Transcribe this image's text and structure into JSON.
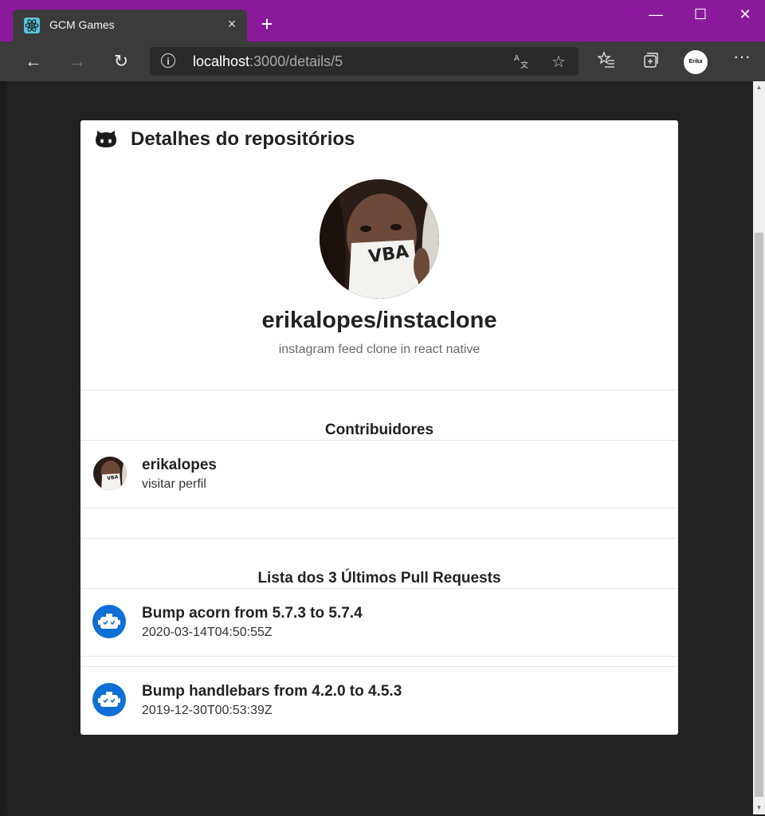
{
  "browser": {
    "tab_title": "GCM Games",
    "tab_close": "×",
    "new_tab": "+",
    "window_controls": {
      "minimize": "—",
      "maximize": "☐",
      "close": "✕"
    },
    "nav": {
      "back": "←",
      "forward": "→",
      "refresh": "↻"
    },
    "address": {
      "host": "localhost",
      "path": ":3000/details/5"
    },
    "toolbar_icons": [
      "translate-icon",
      "favorite-star-icon",
      "favorites-list-icon",
      "collections-icon",
      "profile-avatar",
      "more-menu-icon"
    ],
    "profile_label": "Erika",
    "more": "···"
  },
  "page": {
    "header_title": "Detalhes do repositórios",
    "repo": {
      "name": "erikalopes/instaclone",
      "description": "instagram feed clone in react native"
    },
    "contributors": {
      "title": "Contribuidores",
      "items": [
        {
          "login": "erikalopes",
          "link_text": "visitar perfil"
        }
      ]
    },
    "pull_requests": {
      "title": "Lista dos 3 Últimos Pull Requests",
      "items": [
        {
          "title": "Bump acorn from 5.7.3 to 5.7.4",
          "date": "2020-03-14T04:50:55Z"
        },
        {
          "title": "Bump handlebars from 4.2.0 to 4.5.3",
          "date": "2019-12-30T00:53:39Z"
        }
      ]
    }
  },
  "colors": {
    "titlebar": "#8a1a9b",
    "toolbar": "#3b3b3b",
    "page_background": "#222222",
    "card": "#ffffff",
    "bot_avatar": "#0f6fd6"
  }
}
